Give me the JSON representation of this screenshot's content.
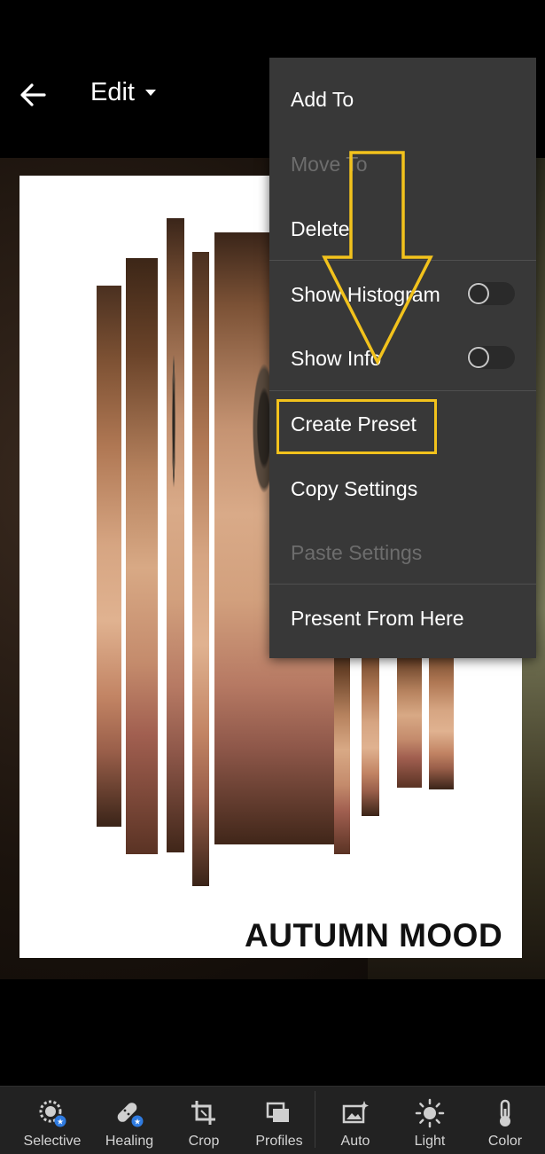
{
  "header": {
    "title": "Edit"
  },
  "photo": {
    "caption": "AUTUMN MOOD"
  },
  "menu": {
    "items": [
      {
        "label": "Add To",
        "enabled": true
      },
      {
        "label": "Move To",
        "enabled": false
      },
      {
        "label": "Delete",
        "enabled": true
      },
      {
        "label": "Show Histogram",
        "enabled": true,
        "toggle": false
      },
      {
        "label": "Show Info",
        "enabled": true,
        "toggle": false
      },
      {
        "label": "Create Preset",
        "enabled": true,
        "highlighted": true
      },
      {
        "label": "Copy Settings",
        "enabled": true
      },
      {
        "label": "Paste Settings",
        "enabled": false
      },
      {
        "label": "Present From Here",
        "enabled": true
      }
    ]
  },
  "annotation": {
    "color": "#f2c21c"
  },
  "toolbar": {
    "tools": [
      {
        "label": "Selective",
        "icon": "selective-icon"
      },
      {
        "label": "Healing",
        "icon": "healing-icon"
      },
      {
        "label": "Crop",
        "icon": "crop-icon"
      },
      {
        "label": "Profiles",
        "icon": "profiles-icon"
      },
      {
        "label": "Auto",
        "icon": "auto-icon"
      },
      {
        "label": "Light",
        "icon": "light-icon"
      },
      {
        "label": "Color",
        "icon": "color-icon"
      }
    ]
  },
  "colors": {
    "background": "#000000",
    "menu_bg": "#383838",
    "toolbar_bg": "#222222",
    "highlight": "#f2c21c",
    "disabled_text": "#6d6d6d"
  }
}
